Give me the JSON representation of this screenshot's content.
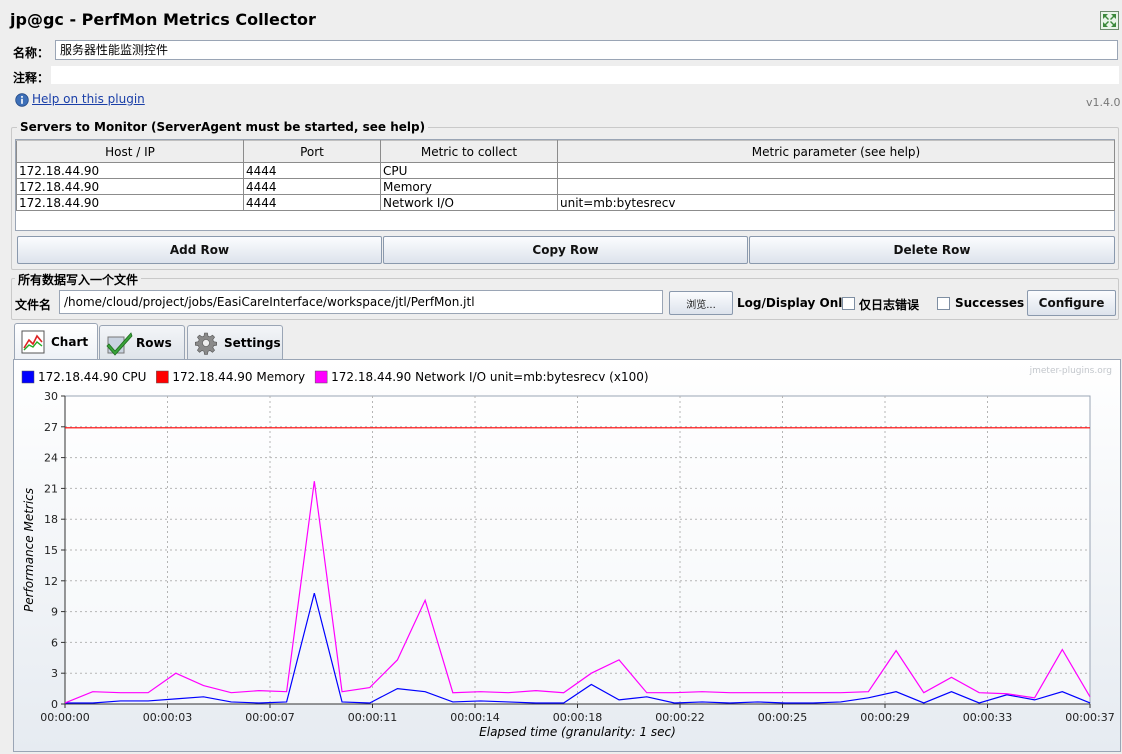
{
  "window": {
    "title": "jp@gc - PerfMon Metrics Collector"
  },
  "fields": {
    "name_label": "名称：",
    "name_value": "服务器性能监测控件",
    "comment_label": "注释：",
    "comment_value": "",
    "help_link": "Help on this plugin",
    "version": "v1.4.0"
  },
  "servers": {
    "group_title": "Servers to Monitor (ServerAgent must be started, see help)",
    "columns": [
      "Host / IP",
      "Port",
      "Metric to collect",
      "Metric parameter (see help)"
    ],
    "rows": [
      [
        "172.18.44.90",
        "4444",
        "CPU",
        ""
      ],
      [
        "172.18.44.90",
        "4444",
        "Memory",
        ""
      ],
      [
        "172.18.44.90",
        "4444",
        "Network I/O",
        "unit=mb:bytesrecv"
      ]
    ],
    "add_row": "Add Row",
    "copy_row": "Copy Row",
    "delete_row": "Delete Row"
  },
  "file": {
    "group_title": "所有数据写入一个文件",
    "filename_label": "文件名",
    "filename_value": "/home/cloud/project/jobs/EasiCareInterface/workspace/jtl/PerfMon.jtl",
    "browse": "浏览...",
    "log_display_only": "Log/Display Only:",
    "errors_only": "仅日志错误",
    "successes": "Successes",
    "configure": "Configure"
  },
  "tabs": [
    {
      "label": "Chart",
      "icon": "chart-icon"
    },
    {
      "label": "Rows",
      "icon": "checkmark-icon"
    },
    {
      "label": "Settings",
      "icon": "gear-icon"
    }
  ],
  "watermark": "jmeter-plugins.org",
  "chart_data": {
    "type": "line",
    "xlabel": "Elapsed time (granularity: 1 sec)",
    "ylabel": "Performance Metrics",
    "ylim": [
      0,
      30
    ],
    "yticks": [
      "0",
      "3",
      "6",
      "9",
      "12",
      "15",
      "18",
      "21",
      "24",
      "27",
      "30"
    ],
    "xticks": [
      "00:00:00",
      "00:00:03",
      "00:00:07",
      "00:00:11",
      "00:00:14",
      "00:00:18",
      "00:00:22",
      "00:00:25",
      "00:00:29",
      "00:00:33",
      "00:00:37"
    ],
    "xlim": [
      0,
      37
    ],
    "legend_position": "top-left",
    "grid": true,
    "series": [
      {
        "name": "172.18.44.90 CPU",
        "color": "#0000ff",
        "x": [
          0,
          1,
          2,
          3,
          4,
          5,
          6,
          7,
          8,
          9,
          10,
          11,
          12,
          13,
          14,
          15,
          16,
          17,
          18,
          19,
          20,
          21,
          22,
          23,
          24,
          25,
          26,
          27,
          28,
          29,
          30,
          31,
          32,
          33,
          34,
          35,
          36,
          37
        ],
        "values": [
          0.1,
          0.1,
          0.3,
          0.3,
          0.5,
          0.7,
          0.2,
          0.1,
          0.2,
          10.8,
          0.2,
          0.1,
          1.5,
          1.2,
          0.2,
          0.3,
          0.2,
          0.1,
          0.1,
          1.9,
          0.4,
          0.7,
          0.1,
          0.2,
          0.1,
          0.2,
          0.1,
          0.1,
          0.2,
          0.6,
          1.2,
          0.1,
          1.2,
          0.1,
          0.9,
          0.4,
          1.2,
          0.1
        ]
      },
      {
        "name": "172.18.44.90 Memory",
        "color": "#ff0000",
        "x": [
          0,
          37
        ],
        "values": [
          26.9,
          26.9
        ]
      },
      {
        "name": "172.18.44.90 Network I/O unit=mb:bytesrecv (x100)",
        "color": "#ff00ff",
        "x": [
          0,
          1,
          2,
          3,
          4,
          5,
          6,
          7,
          8,
          9,
          10,
          11,
          12,
          13,
          14,
          15,
          16,
          17,
          18,
          19,
          20,
          21,
          22,
          23,
          24,
          25,
          26,
          27,
          28,
          29,
          30,
          31,
          32,
          33,
          34,
          35,
          36,
          37
        ],
        "values": [
          0.1,
          1.2,
          1.1,
          1.1,
          3.0,
          1.8,
          1.1,
          1.3,
          1.2,
          21.7,
          1.2,
          1.6,
          4.3,
          10.1,
          1.1,
          1.2,
          1.1,
          1.3,
          1.1,
          3.0,
          4.3,
          1.1,
          1.1,
          1.2,
          1.1,
          1.1,
          1.1,
          1.1,
          1.1,
          1.2,
          5.2,
          1.1,
          2.6,
          1.1,
          1.0,
          0.6,
          5.3,
          0.7
        ]
      }
    ]
  }
}
